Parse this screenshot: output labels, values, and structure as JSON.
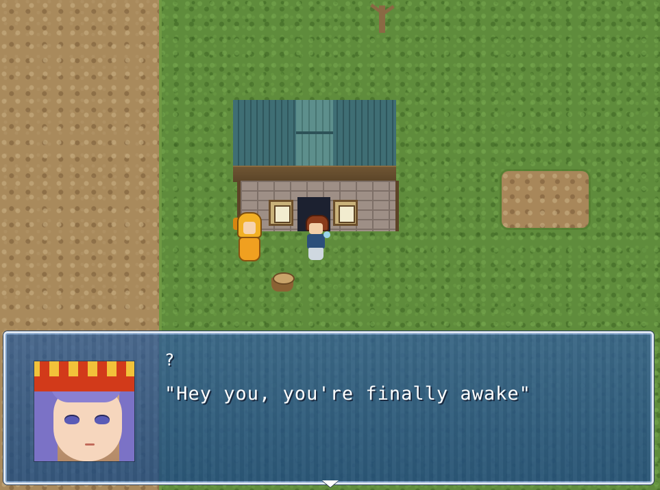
{
  "message": {
    "speaker": "?",
    "text": "\"Hey you, you're finally awake\""
  },
  "icons": [
    "advance-arrow-icon"
  ]
}
